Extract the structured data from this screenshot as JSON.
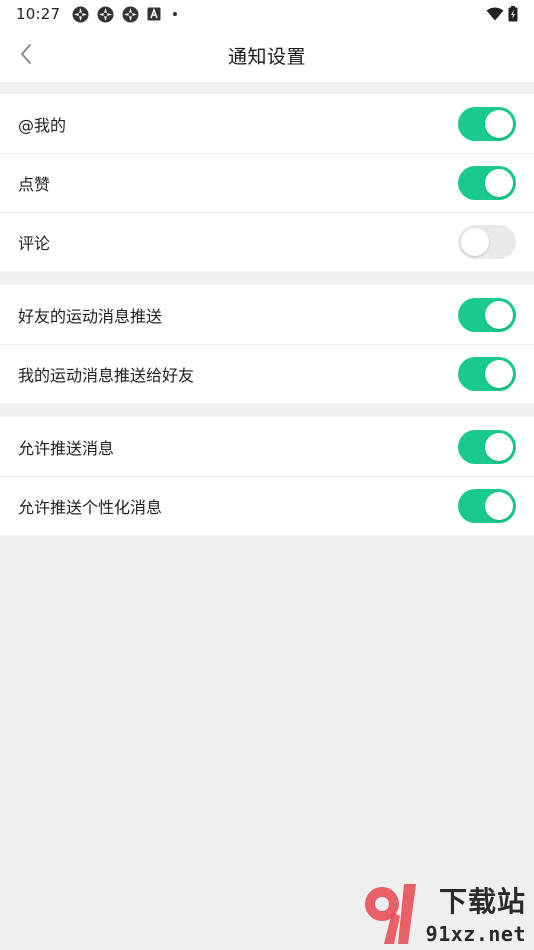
{
  "status_bar": {
    "time": "10:27",
    "left_icons": [
      "app-notification-icon",
      "app-notification-icon",
      "app-notification-icon",
      "keyboard-a-icon",
      "more-dot-icon"
    ],
    "right_icons": [
      "wifi-icon",
      "battery-icon"
    ]
  },
  "header": {
    "back_icon": "chevron-left-icon",
    "title": "通知设置"
  },
  "colors": {
    "toggle_on": "#19c98f",
    "toggle_off": "#e9e9e9",
    "page_bg": "#efefef"
  },
  "sections": [
    {
      "items": [
        {
          "label": "@我的",
          "enabled": true
        },
        {
          "label": "点赞",
          "enabled": true
        },
        {
          "label": "评论",
          "enabled": false
        }
      ]
    },
    {
      "items": [
        {
          "label": "好友的运动消息推送",
          "enabled": true
        },
        {
          "label": "我的运动消息推送给好友",
          "enabled": true
        }
      ]
    },
    {
      "items": [
        {
          "label": "允许推送消息",
          "enabled": true
        },
        {
          "label": "允许推送个性化消息",
          "enabled": true
        }
      ]
    }
  ],
  "watermark": {
    "text": "下载站",
    "url": "91xz.net"
  }
}
